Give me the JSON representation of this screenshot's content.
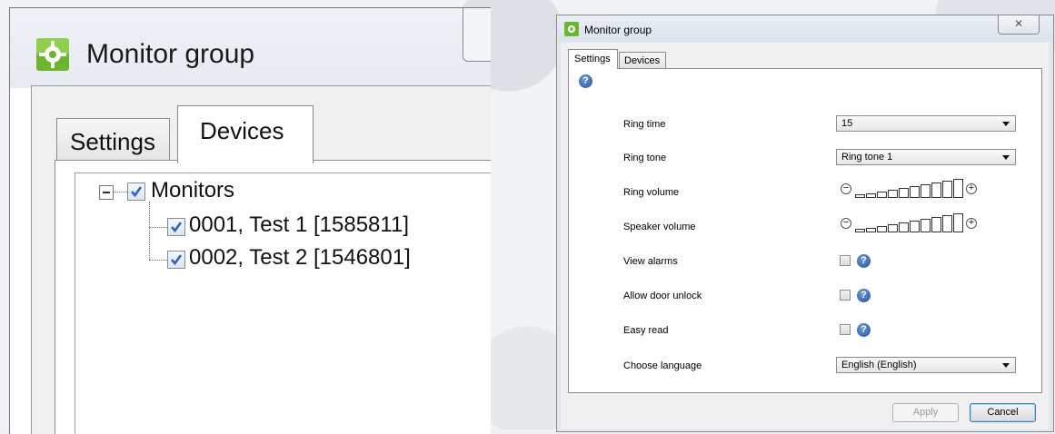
{
  "zoom": {
    "window_title": "Monitor group",
    "tabs": [
      {
        "label": "Settings",
        "active": false
      },
      {
        "label": "Devices",
        "active": true
      }
    ],
    "tree": {
      "root": {
        "label": "Monitors",
        "checked": true,
        "expanded": true
      },
      "children": [
        {
          "label": "0001, Test 1 [1585811]",
          "checked": true
        },
        {
          "label": "0002, Test 2 [1546801]",
          "checked": true
        }
      ]
    }
  },
  "dialog": {
    "window_title": "Monitor group",
    "close_glyph": "✕",
    "tabs": [
      {
        "label": "Settings",
        "active": true
      },
      {
        "label": "Devices",
        "active": false
      }
    ],
    "help_glyph": "?",
    "settings": {
      "ring_time": {
        "label": "Ring time",
        "value": "15"
      },
      "ring_tone": {
        "label": "Ring tone",
        "value": "Ring tone 1"
      },
      "ring_volume": {
        "label": "Ring volume",
        "minus": "−",
        "plus": "+"
      },
      "speaker_volume": {
        "label": "Speaker volume",
        "minus": "−",
        "plus": "+"
      },
      "view_alarms": {
        "label": "View alarms",
        "checked": false
      },
      "allow_door_unlock": {
        "label": "Allow door unlock",
        "checked": false
      },
      "easy_read": {
        "label": "Easy read",
        "checked": false
      },
      "language": {
        "label": "Choose language",
        "value": "English (English)"
      }
    },
    "buttons": {
      "apply": "Apply",
      "cancel": "Cancel"
    }
  },
  "colors": {
    "accent_blue": "#1f4f9c",
    "icon_green": "#5fae2e",
    "check_blue": "#2a62c9"
  },
  "icons": {
    "app": "gear-green-icon",
    "help": "help-circle-icon",
    "check": "checkmark-icon"
  }
}
